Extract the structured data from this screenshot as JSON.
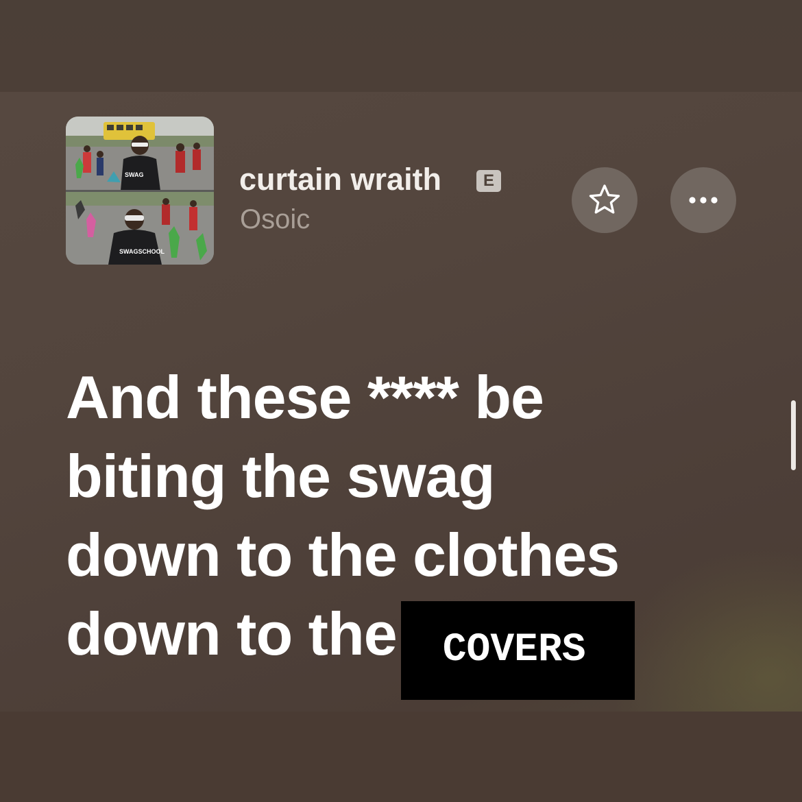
{
  "track": {
    "title": "curtain wraith",
    "explicit_badge": "E",
    "artist": "Osoic"
  },
  "actions": {
    "favorite_icon": "star-outline-icon",
    "more_icon": "ellipsis-icon"
  },
  "lyrics": {
    "lines": [
      "And these **** be",
      "biting the swag",
      "down to the clothes",
      "down to the"
    ],
    "redacted_word": "COVERS"
  },
  "colors": {
    "background": "#53453d",
    "lyric_text": "#ffffff",
    "secondary_text": "#a99f97",
    "button_fill": "#716760",
    "redaction_fill": "#000000"
  }
}
